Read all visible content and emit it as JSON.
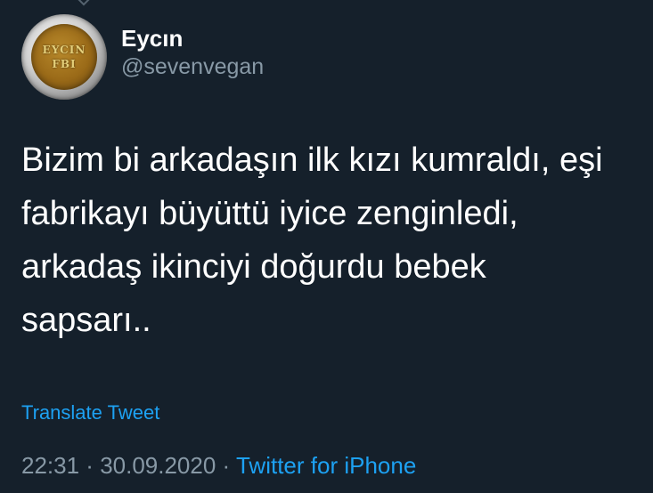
{
  "author": {
    "display_name": "Eycın",
    "handle": "@sevenvegan",
    "avatar_text_line1": "EYCIN",
    "avatar_text_line2": "FBI"
  },
  "tweet": {
    "text": "Bizim bi arkadaşın ilk kızı kumraldı, eşi\nfabrikayı büyüttü iyice zenginledi,\narkadaş ikinciyi doğurdu bebek\nsapsarı..",
    "translate_label": "Translate Tweet",
    "time": "22:31",
    "separator1": " · ",
    "date": "30.09.2020",
    "separator2": " · ",
    "source": "Twitter for iPhone"
  },
  "colors": {
    "background": "#15202b",
    "text": "#ffffff",
    "secondary": "#8899a6",
    "accent": "#1da1f2"
  }
}
